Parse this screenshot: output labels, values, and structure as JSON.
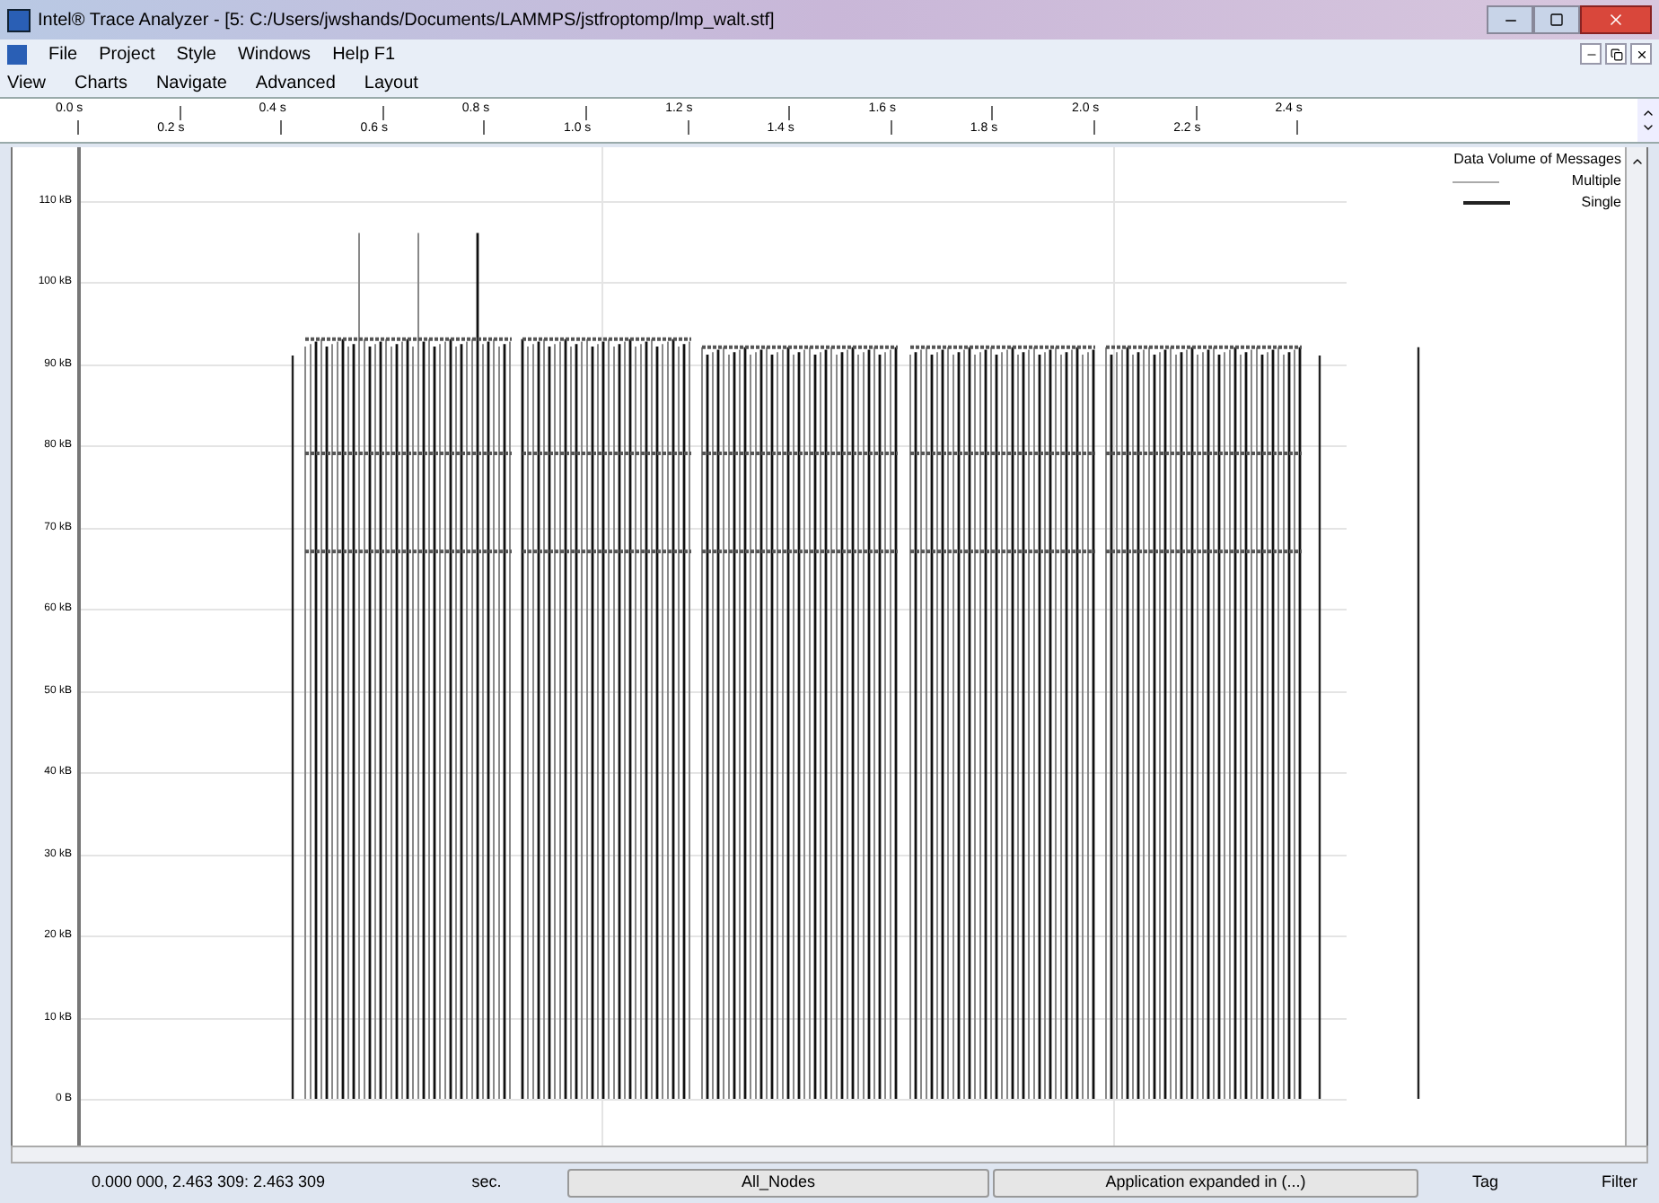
{
  "window": {
    "title": "Intel® Trace Analyzer - [5: C:/Users/jwshands/Documents/LAMMPS/jstfroptomp/lmp_walt.stf]"
  },
  "menu_bar": [
    "File",
    "Project",
    "Style",
    "Windows",
    "Help F1"
  ],
  "chart_menu": [
    "View",
    "Charts",
    "Navigate",
    "Advanced",
    "Layout"
  ],
  "time_ruler": [
    "0.0 s",
    "0.2 s",
    "0.4 s",
    "0.6 s",
    "0.8 s",
    "1.0 s",
    "1.2 s",
    "1.4 s",
    "1.6 s",
    "1.8 s",
    "2.0 s",
    "2.2 s",
    "2.4 s"
  ],
  "y_axis": [
    "110 kB",
    "100 kB",
    "90 kB",
    "80 kB",
    "70 kB",
    "60 kB",
    "50 kB",
    "40 kB",
    "30 kB",
    "20 kB",
    "10 kB",
    "0 B"
  ],
  "legend": {
    "title": "Data Volume of Messages",
    "entries": [
      {
        "label": "Multiple",
        "kind": "light"
      },
      {
        "label": "Single",
        "kind": "dark"
      }
    ]
  },
  "status_bar": {
    "range": "0.000 000, 2.463 309: 2.463 309",
    "unit": "sec.",
    "nodes_button": "All_Nodes",
    "function_button": "Application expanded in (...)",
    "tag": "Tag",
    "filter": "Filter"
  }
}
